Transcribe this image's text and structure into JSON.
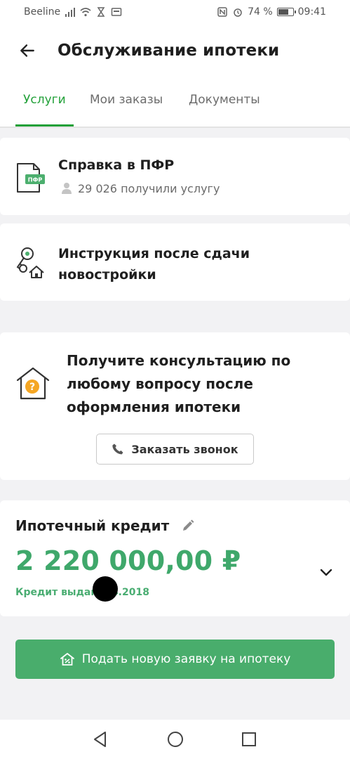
{
  "status_bar": {
    "carrier": "Beeline",
    "battery_text": "74 %",
    "battery_level": 0.74,
    "time": "09:41"
  },
  "header": {
    "title": "Обслуживание ипотеки"
  },
  "tabs": [
    {
      "label": "Услуги",
      "active": true
    },
    {
      "label": "Мои заказы",
      "active": false
    },
    {
      "label": "Документы",
      "active": false
    }
  ],
  "services": {
    "pfr": {
      "icon_text": "ПФР",
      "title": "Справка в ПФР",
      "subtitle": "29 026 получили услугу"
    },
    "instruction": {
      "title": "Инструкция после сдачи новостройки"
    }
  },
  "consult": {
    "title": "Получите консультацию по любому вопросу после оформления ипотеки",
    "button_label": "Заказать звонок"
  },
  "credit": {
    "title": "Ипотечный кредит",
    "amount": "2 220 000,00 ₽",
    "issued_text": "Кредит выдан .04.2018"
  },
  "apply_button": {
    "label": "Подать новую заявку на ипотеку"
  },
  "colors": {
    "accent": "#21a038",
    "amount": "#3fa86b",
    "apply_button": "#49ad6c",
    "pfr_badge": "#4caf6e",
    "question_badge": "#f5a623"
  }
}
